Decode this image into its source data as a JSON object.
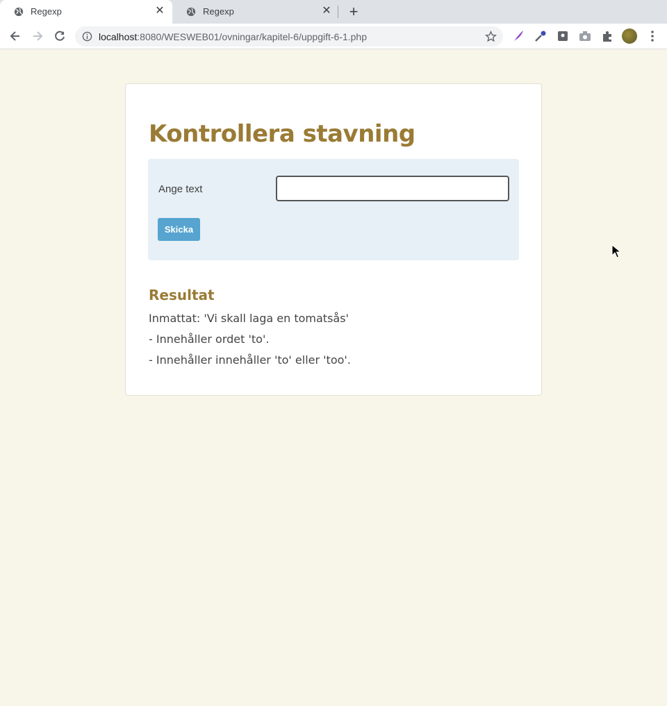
{
  "browser": {
    "tabs": [
      {
        "title": "Regexp",
        "active": true
      },
      {
        "title": "Regexp",
        "active": false
      }
    ],
    "url_host": "localhost",
    "url_path": ":8080/WESWEB01/ovningar/kapitel-6/uppgift-6-1.php"
  },
  "page": {
    "heading": "Kontrollera stavning",
    "form": {
      "label": "Ange text",
      "input_value": "",
      "submit_label": "Skicka"
    },
    "result": {
      "title": "Resultat",
      "lines": [
        "Inmattat: 'Vi skall laga en tomatsås'",
        "- Innehåller ordet 'to'.",
        "- Innehåller innehåller 'to' eller 'too'."
      ]
    }
  },
  "colors": {
    "page_bg": "#f8f5e9",
    "heading": "#9a7b35",
    "form_bg": "#e6f0f6",
    "button": "#56a4cf"
  }
}
